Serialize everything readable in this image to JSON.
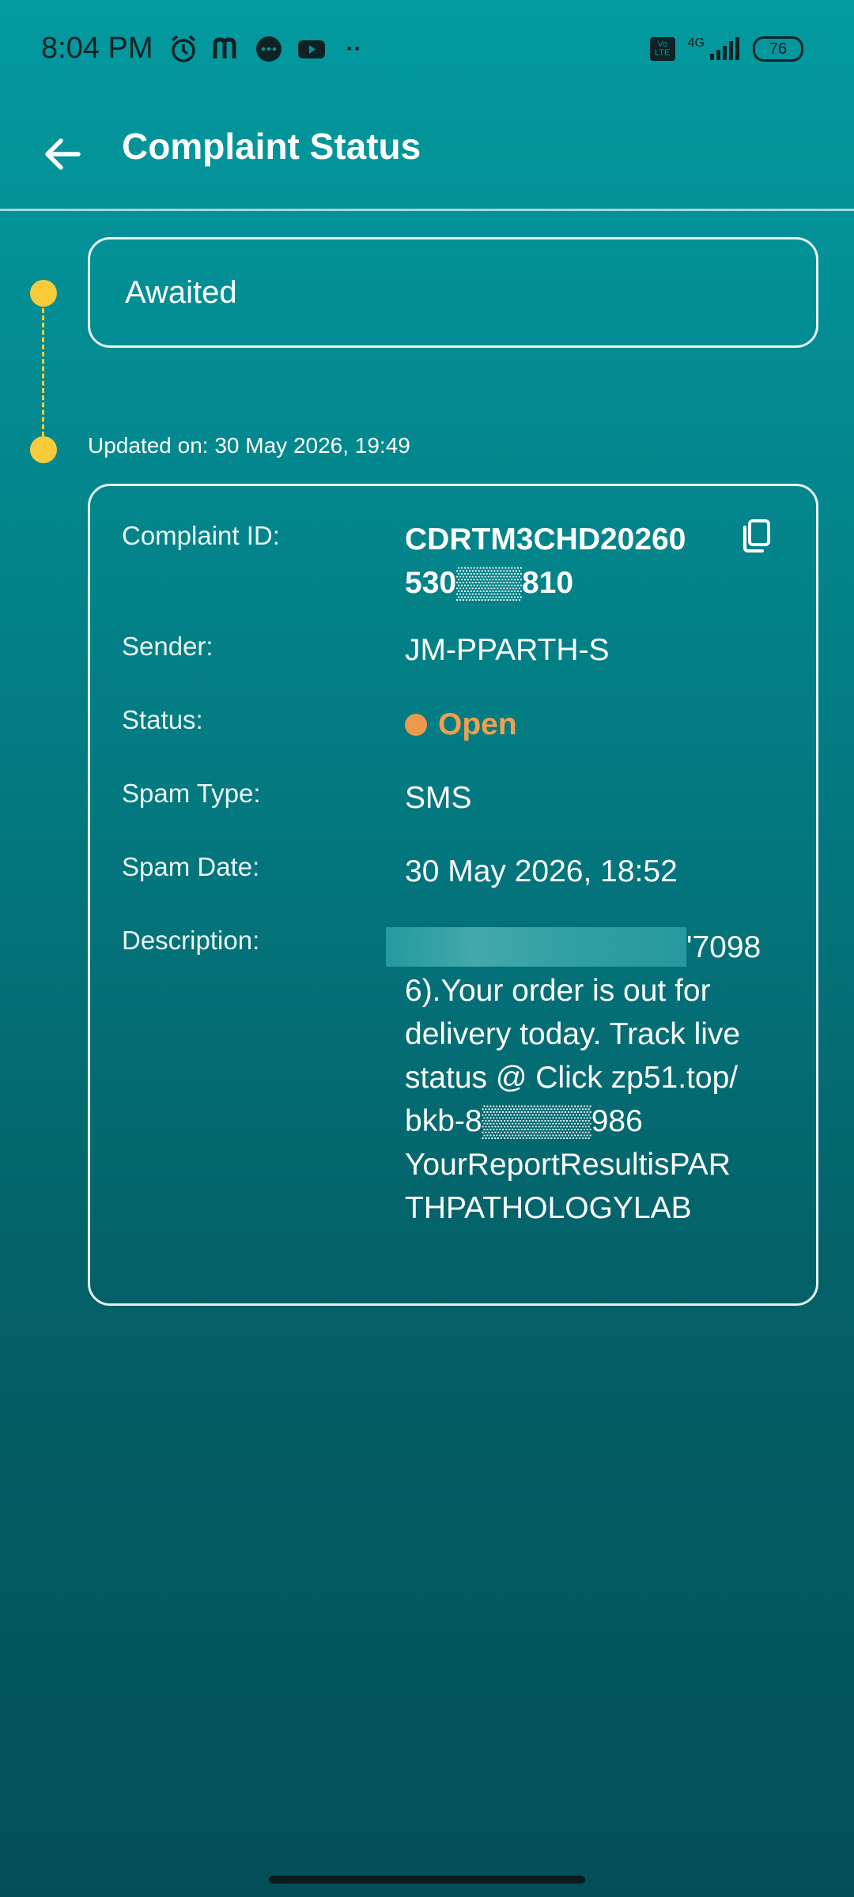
{
  "status_bar": {
    "time": "8:04 PM",
    "network": "4G",
    "volte": "Vo LTE",
    "battery": "76",
    "more": "··"
  },
  "app_bar": {
    "title": "Complaint Status"
  },
  "timeline": {
    "awaited_label": "Awaited",
    "updated_on": "Updated on: 30 May 2026, 19:49"
  },
  "details": {
    "complaint_id_label": "Complaint ID:",
    "complaint_id_line1": "CDRTM3CHD20260",
    "complaint_id_line2": "530▒▒▒810",
    "sender_label": "Sender:",
    "sender_value": "JM-PPARTH-S",
    "status_label": "Status:",
    "status_value": "Open",
    "spam_type_label": "Spam Type:",
    "spam_type_value": "SMS",
    "spam_date_label": "Spam Date:",
    "spam_date_value": "30 May 2026, 18:52",
    "description_label": "Description:",
    "description_lines": [
      "'7098",
      "6).Your order is out for",
      "delivery today. Track live",
      "status @ Click zp51.top/",
      "bkb-8▒▒▒▒▒986",
      "YourReportResultisPAR",
      "THPATHOLOGYLAB"
    ]
  },
  "colors": {
    "accent_yellow": "#f9cb3a",
    "status_open": "#f0a04e",
    "background_top": "#039aa0",
    "background_bottom": "#034f57"
  }
}
